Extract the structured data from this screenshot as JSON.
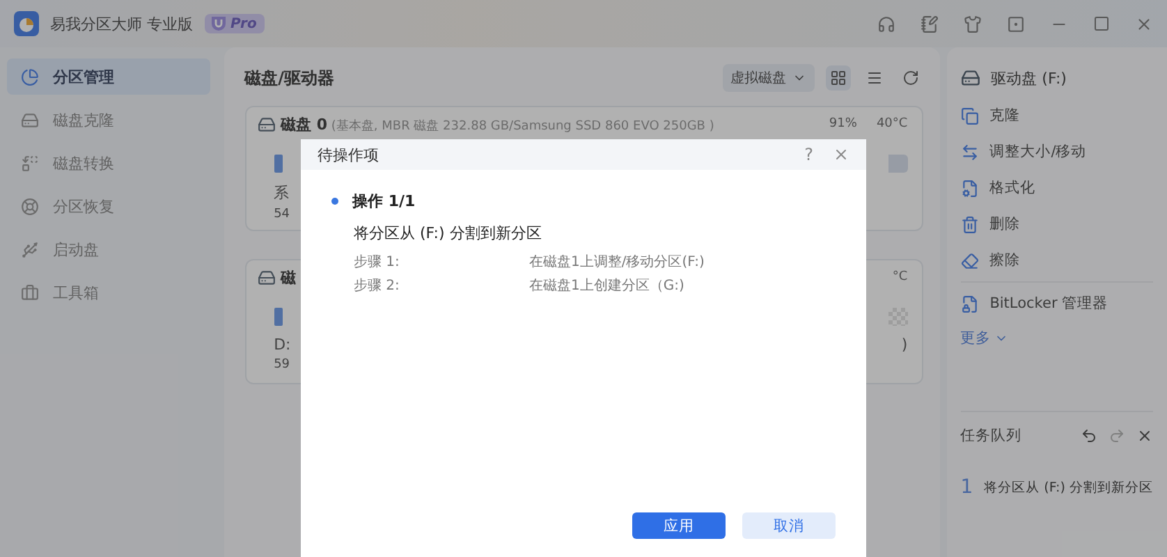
{
  "app": {
    "title": "易我分区大师 专业版",
    "badge": "Pro"
  },
  "sidebar": [
    {
      "label": "分区管理",
      "selected": true
    },
    {
      "label": "磁盘克隆",
      "selected": false
    },
    {
      "label": "磁盘转换",
      "selected": false
    },
    {
      "label": "分区恢复",
      "selected": false
    },
    {
      "label": "启动盘",
      "selected": false
    },
    {
      "label": "工具箱",
      "selected": false
    }
  ],
  "main": {
    "title": "磁盘/驱动器",
    "dropdown": "虚拟磁盘",
    "views": [
      {
        "kind": "grid",
        "selected": true
      },
      {
        "kind": "list",
        "selected": false
      }
    ]
  },
  "disks": [
    {
      "header": "**磁盘 0** (基本盘, MBR 磁盘 232.88 GB/Samsung SSD 860 EVO 250GB )",
      "usage": "91%",
      "temp": "40°C",
      "left_lines": [
        "系",
        "54"
      ],
      "kind": "used"
    },
    {
      "header": "**磁**",
      "temp": "°C",
      "left_lines": [
        "D:",
        "59"
      ],
      "right_lines": [
        ")"
      ],
      "kind": "unallocated"
    }
  ],
  "drive": {
    "title": "驱动盘 (F:)",
    "actions": [
      "克隆",
      "调整大小/移动",
      "格式化",
      "删除",
      "擦除"
    ],
    "extra_actions": [
      "BitLocker 管理器"
    ],
    "more": "更多"
  },
  "task_queue": {
    "title": "任务队列",
    "items": [
      {
        "number": "1",
        "text": "将分区从 (F:) 分割到新分区"
      }
    ]
  },
  "dialog": {
    "title": "待操作项",
    "help": "?",
    "operation": "操作 1/1",
    "description": "将分区从 (F:) 分割到新分区",
    "steps": [
      {
        "label": "步骤 1:",
        "value": "在磁盘1上调整/移动分区(F:)"
      },
      {
        "label": "步骤 2:",
        "value": "在磁盘1上创建分区（G:)"
      }
    ],
    "buttons": [
      {
        "label": "应用",
        "kind": "primary"
      },
      {
        "label": "取消",
        "kind": "secondary"
      }
    ]
  }
}
